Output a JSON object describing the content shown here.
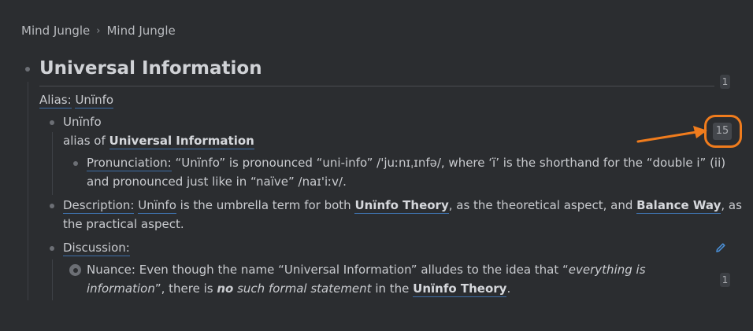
{
  "breadcrumb": {
    "items": [
      "Mind Jungle",
      "Mind Jungle"
    ],
    "separator": "›"
  },
  "page": {
    "title": "Universal Information",
    "title_ref_count": "1"
  },
  "alias_line": {
    "label": "Alias:",
    "value": "Unïnfo"
  },
  "block_uninfo": {
    "title": "Unïnfo",
    "alias_prefix": "alias of",
    "alias_target": "Universal Information",
    "ref_count": "15"
  },
  "pronunciation": {
    "label": "Pronunciation:",
    "line1": "“Unïnfo” is pronounced “uni-info” /'juːnɪˌɪnfə/, where ‘ï’ is the shorthand for the “double i” (ii)",
    "line2": "and pronounced just like in “naïve” /naɪ'iːv/."
  },
  "description": {
    "label": "Description:",
    "link1": "Unïnfo",
    "text1": " is the umbrella term for both ",
    "link2": "Unïnfo Theory",
    "text2": ", as the theoretical aspect, and ",
    "link3": "Balance Way",
    "text3": ", as",
    "line2": "the practical aspect."
  },
  "discussion": {
    "label": "Discussion:"
  },
  "nuance": {
    "prefix": "Nuance: Even though the name “Universal Information” alludes to the idea that “",
    "italic1": "everything is",
    "italic2": "information",
    "mid1": "”, there is ",
    "strong": "no",
    "italic3": " such formal statement",
    "mid2": " in the ",
    "link": "Unïnfo Theory",
    "end": ".",
    "ref_count": "1"
  },
  "colors": {
    "accent_link": "#3e6fa8",
    "annotation": "#f07c1d",
    "background": "#2b2d30"
  },
  "icons": [
    "chevron-right-icon",
    "edit-pencil-icon",
    "annotation-arrow-icon"
  ]
}
